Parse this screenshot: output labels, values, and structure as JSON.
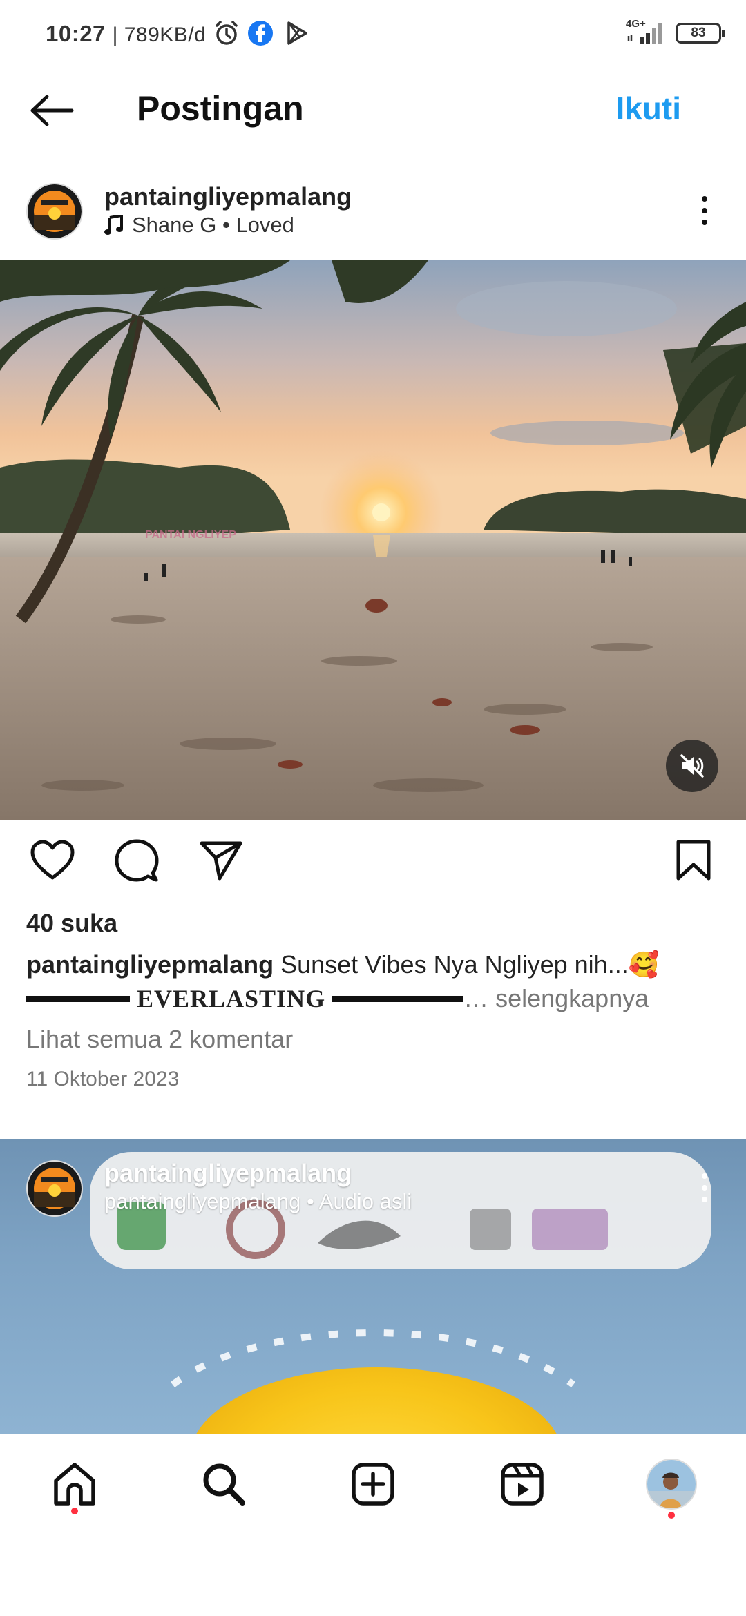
{
  "status_bar": {
    "time": "10:27",
    "speed": "| 789KB/d",
    "network": "4G+",
    "battery": "83",
    "icons": [
      "alarm-icon",
      "facebook-icon",
      "play-store-icon",
      "signal-icon",
      "battery-icon"
    ]
  },
  "header": {
    "title": "Postingan",
    "follow_label": "Ikuti"
  },
  "post": {
    "username": "pantaingliyepmalang",
    "music": "Shane G • Loved",
    "likes": "40 suka",
    "caption_user": "pantaingliyepmalang",
    "caption_text": "Sunset Vibes Nya Ngliyep nih...🥰",
    "caption_line2_text": "EVERLASTING",
    "caption_more": "… selengkapnya",
    "view_comments": "Lihat semua 2 komentar",
    "date": "11 Oktober 2023"
  },
  "next_post": {
    "username": "pantaingliyepmalang",
    "audio": "pantaingliyepmalang • Audio asli"
  },
  "colors": {
    "accent": "#1d9bf0",
    "notification_dot": "#ff3040"
  }
}
